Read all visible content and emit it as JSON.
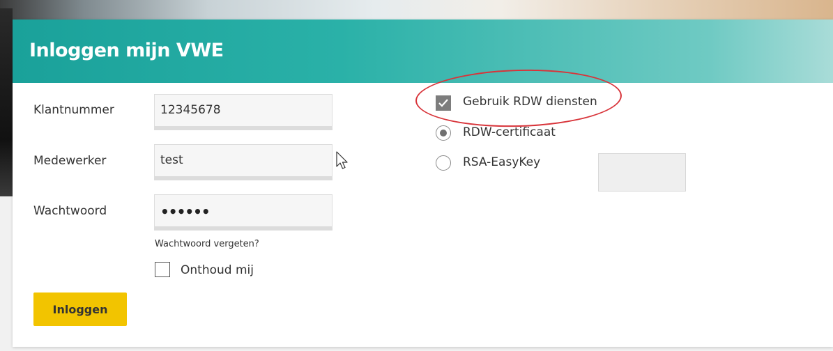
{
  "header": {
    "title": "Inloggen mijn VWE"
  },
  "form": {
    "customer_number": {
      "label": "Klantnummer",
      "value": "12345678"
    },
    "employee": {
      "label": "Medewerker",
      "value": "test"
    },
    "password": {
      "label": "Wachtwoord",
      "masked_value": "••••••"
    },
    "forgot_link": "Wachtwoord vergeten?",
    "remember": {
      "label": "Onthoud mij",
      "checked": false
    },
    "submit_label": "Inloggen"
  },
  "rdw": {
    "use_services": {
      "label": "Gebruik RDW diensten",
      "checked": true
    },
    "options": [
      {
        "label": "RDW-certificaat",
        "selected": true
      },
      {
        "label": "RSA-EasyKey",
        "selected": false
      }
    ],
    "token_value": ""
  },
  "colors": {
    "header": "#2ab1a8",
    "button": "#f2c400",
    "highlight": "#d8343a"
  }
}
